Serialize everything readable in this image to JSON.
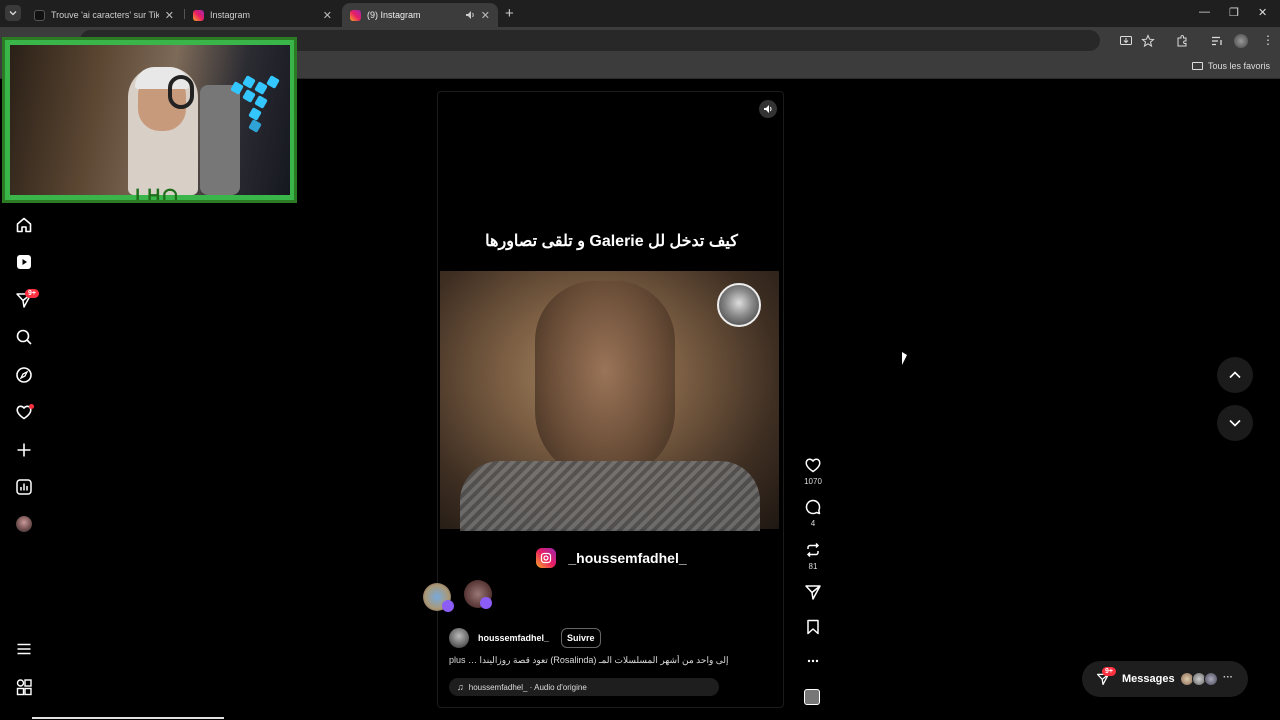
{
  "browser": {
    "tabs": [
      {
        "title": "Trouve 'ai caracters' sur TikTok |",
        "active": false
      },
      {
        "title": "Instagram",
        "active": false
      },
      {
        "title": "(9) Instagram",
        "active": true
      }
    ],
    "bookmarks_all_label": "Tous les favoris"
  },
  "nav": {
    "notifications_badge": "9+"
  },
  "reel": {
    "overlay_caption": "كيف تدخل لل Galerie و تلقى تصاورها",
    "watermark_handle": "_houssemfadhel_",
    "author": "houssemfadhel_",
    "follow_label": "Suivre",
    "description": "plus … تعود قصة روزاليندا (Rosalinda) إلى واحد من أشهر المسلسلات المـ",
    "audio": "houssemfadhel_ · Audio d'origine"
  },
  "actions": {
    "likes": "1070",
    "comments": "4",
    "reposts": "81"
  },
  "messages": {
    "label": "Messages",
    "badge": "9+"
  },
  "colors": {
    "accent_red": "#ff3040",
    "background": "#000000",
    "webcam_frame": "#39b54a"
  }
}
